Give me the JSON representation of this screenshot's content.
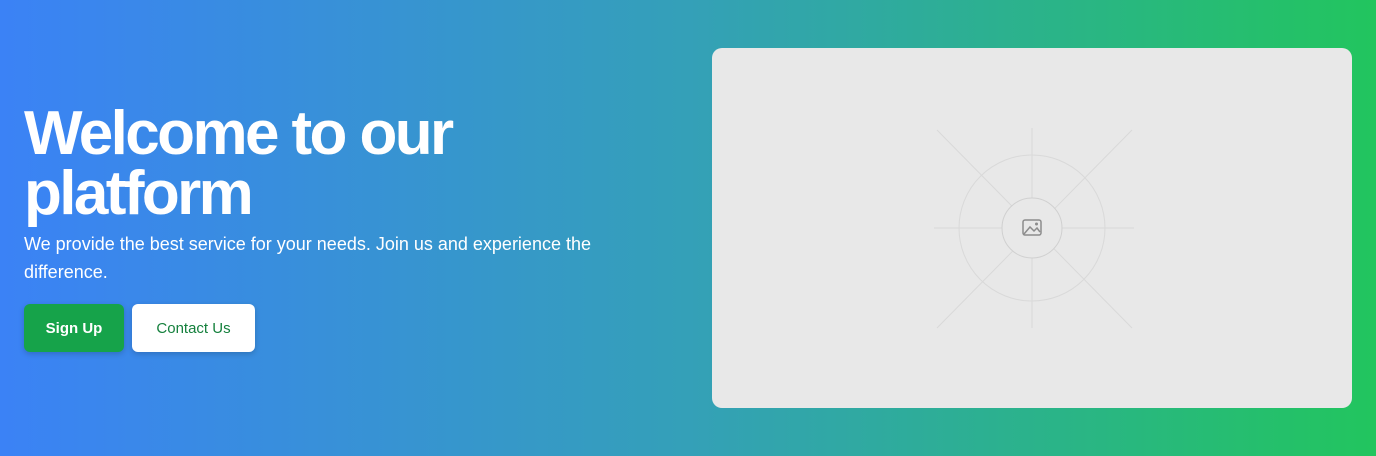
{
  "hero": {
    "title": "Welcome to our platform",
    "subtitle": "We provide the best service for your needs. Join us and experience the difference.",
    "primary_button_label": "Sign Up",
    "secondary_button_label": "Contact Us",
    "media_icon": "image-icon"
  },
  "colors": {
    "gradient_start": "#3b82f6",
    "gradient_end": "#22c55e",
    "primary_button": "#16a34a",
    "secondary_button_text": "#15803d",
    "media_background": "#e8e8e8"
  }
}
